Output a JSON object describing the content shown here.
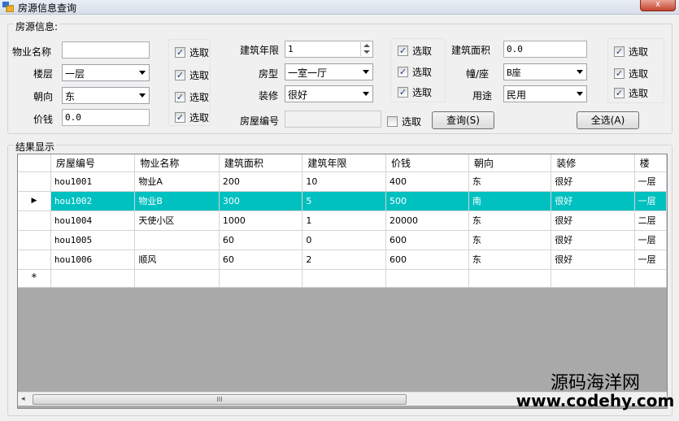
{
  "window": {
    "title": "房源信息查询",
    "close_glyph": "x"
  },
  "filter_group": {
    "title": "房源信息:",
    "property_name": {
      "label": "物业名称",
      "value": ""
    },
    "floor": {
      "label": "楼层",
      "value": "一层"
    },
    "orientation": {
      "label": "朝向",
      "value": "东"
    },
    "price": {
      "label": "价钱",
      "value": "0.0"
    },
    "build_years": {
      "label": "建筑年限",
      "value": "1"
    },
    "room_type": {
      "label": "房型",
      "value": "一室一厅"
    },
    "decoration": {
      "label": "装修",
      "value": "很好"
    },
    "house_no": {
      "label": "房屋编号",
      "value": ""
    },
    "build_area": {
      "label": "建筑面积",
      "value": "0.0"
    },
    "building": {
      "label": "幢/座",
      "value": "B座"
    },
    "usage": {
      "label": "用途",
      "value": "民用"
    },
    "select_label": "选取",
    "check_glyph": "✓",
    "query_button": "查询(S)",
    "select_all_button": "全选(A)"
  },
  "results_group": {
    "title": "结果显示",
    "columns": [
      "房屋编号",
      "物业名称",
      "建筑面积",
      "建筑年限",
      "价钱",
      "朝向",
      "装修",
      "楼"
    ],
    "rows": [
      [
        "hou1001",
        "物业A",
        "200",
        "10",
        "400",
        "东",
        "很好",
        "一层"
      ],
      [
        "hou1002",
        "物业B",
        "300",
        "5",
        "500",
        "南",
        "很好",
        "一层"
      ],
      [
        "hou1004",
        "天使小区",
        "1000",
        "1",
        "20000",
        "东",
        "很好",
        "二层"
      ],
      [
        "hou1005",
        "",
        "60",
        "0",
        "600",
        "东",
        "很好",
        "一层"
      ],
      [
        "hou1006",
        "顺风",
        "60",
        "2",
        "600",
        "东",
        "很好",
        "一层"
      ]
    ],
    "current_row_marker": "▶",
    "new_row_marker": "*",
    "scroll_thumb_grip": "III",
    "scroll_left": "◂",
    "scroll_right": "▸"
  },
  "watermark": {
    "line1": "源码海洋网",
    "line2": "www.codehy.com"
  },
  "colors": {
    "selected_row": "#00c0c0",
    "grid_background": "#a9a9a9"
  }
}
